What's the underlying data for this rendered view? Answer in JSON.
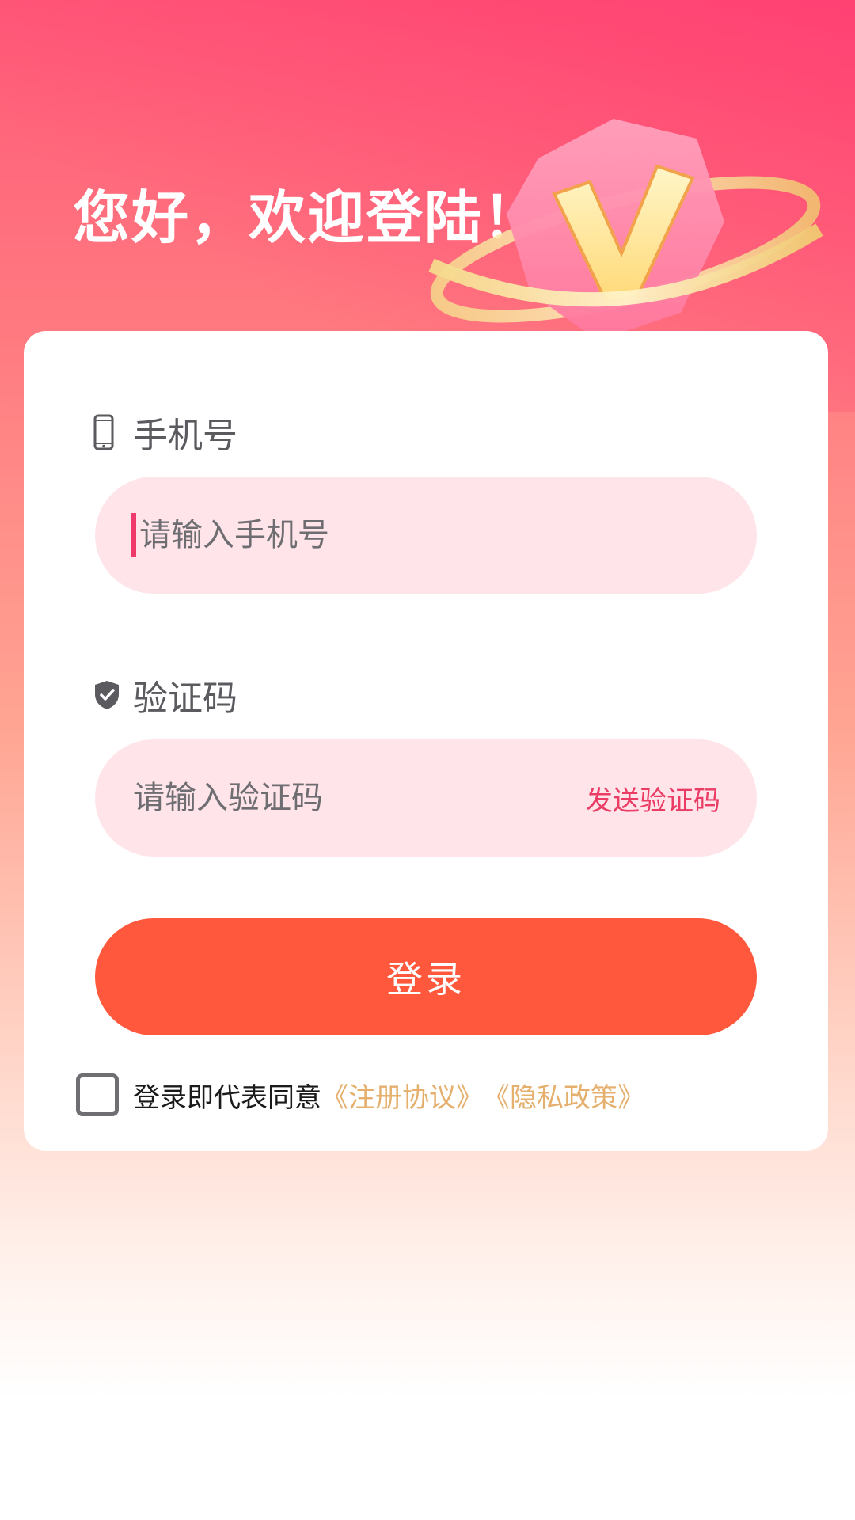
{
  "header": {
    "welcome": "您好，欢迎登陆！"
  },
  "phone": {
    "label": "手机号",
    "icon": "phone-icon",
    "placeholder": "请输入手机号",
    "value": ""
  },
  "code": {
    "label": "验证码",
    "icon": "shield-check-icon",
    "placeholder": "请输入验证码",
    "value": "",
    "send_label": "发送验证码"
  },
  "login": {
    "label": "登录"
  },
  "agreement": {
    "checked": false,
    "prefix": "登录即代表同意",
    "terms_label": "《注册协议》",
    "privacy_label": "《隐私政策》"
  },
  "colors": {
    "accent": "#ff583c",
    "send_code": "#ea3c64",
    "link": "#e5b06e",
    "input_bg": "#ffe4e9"
  }
}
